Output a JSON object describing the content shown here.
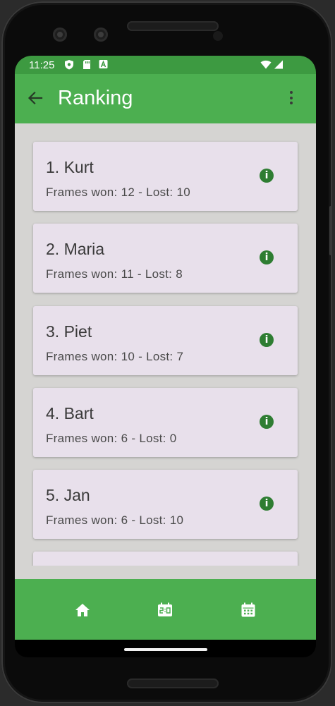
{
  "status_bar": {
    "time": "11:25",
    "icons": [
      "shield-icon",
      "sim-card-icon",
      "a-box-icon",
      "wifi-icon",
      "signal-icon"
    ]
  },
  "app_bar": {
    "title": "Ranking",
    "back_icon": "arrow-back-icon",
    "menu_icon": "more-vert-icon"
  },
  "rankings": [
    {
      "name": "1. Kurt",
      "stats": "Frames won: 12 - Lost: 10"
    },
    {
      "name": "2. Maria",
      "stats": "Frames won: 11 - Lost: 8"
    },
    {
      "name": "3. Piet",
      "stats": "Frames won: 10 - Lost: 7"
    },
    {
      "name": "4. Bart",
      "stats": "Frames won: 6 - Lost: 0"
    },
    {
      "name": "5. Jan",
      "stats": "Frames won: 6 - Lost: 10"
    }
  ],
  "bottom_nav": [
    "home-icon",
    "scoreboard-icon",
    "calendar-icon"
  ],
  "colors": {
    "primary": "#4caf50",
    "status_bar": "#3d9a41",
    "card": "#e8e0eb",
    "background": "#d5d4d2",
    "info_icon": "#2e7d32"
  }
}
